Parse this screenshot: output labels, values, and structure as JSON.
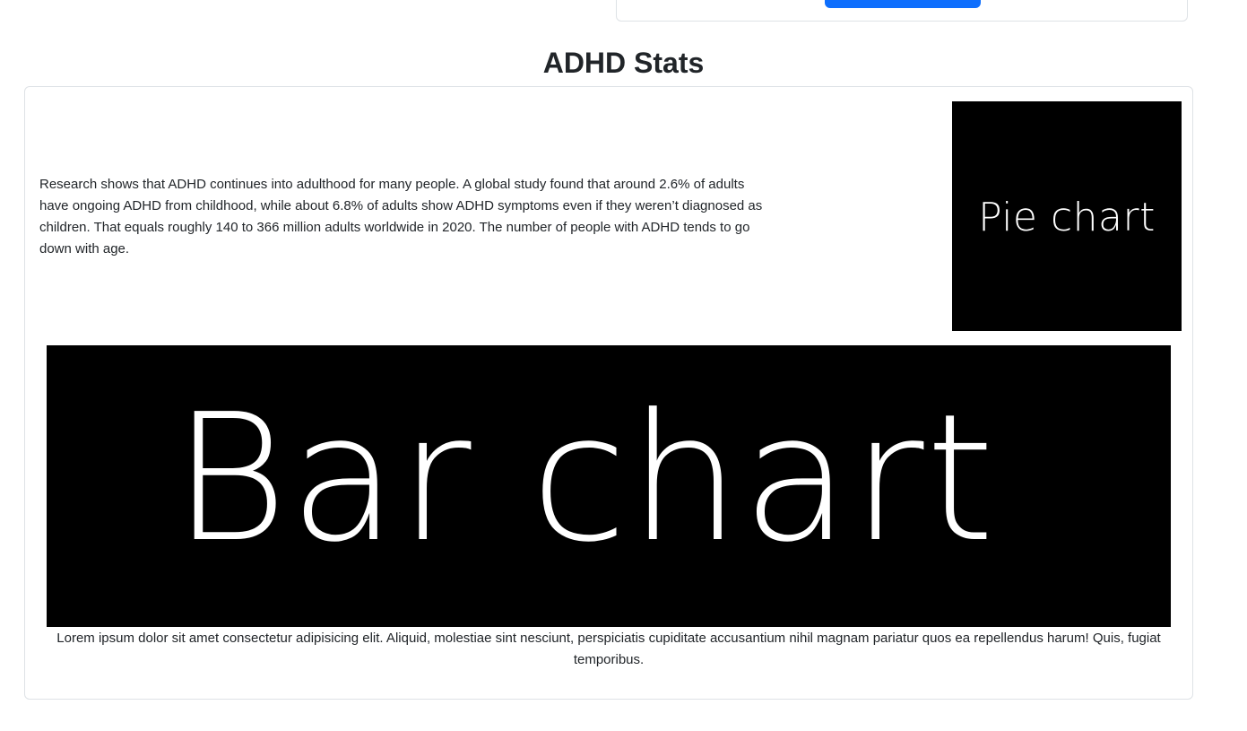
{
  "header_card": {
    "button_label": ""
  },
  "stats": {
    "title": "ADHD Stats",
    "intro": "Research shows that ADHD continues into adulthood for many people. A global study found that around 2.6% of adults have ongoing ADHD from childhood, while about 6.8% of adults show ADHD symptoms even if they weren’t diagnosed as children. That equals roughly 140 to 366 million adults worldwide in 2020. The number of people with ADHD tends to go down with age.",
    "pie_image_label": "Pie chart",
    "bar_image_label": "Bar chart",
    "caption": "Lorem ipsum dolor sit amet consectetur adipisicing elit. Aliquid, molestiae sint nesciunt, perspiciatis cupiditate accusantium nihil magnam pariatur quos ea repellendus harum! Quis, fugiat temporibus."
  },
  "colors": {
    "primary_button": "#0d6efd",
    "card_border": "#dee2e6",
    "placeholder_bg": "#000000",
    "text": "#212529"
  }
}
